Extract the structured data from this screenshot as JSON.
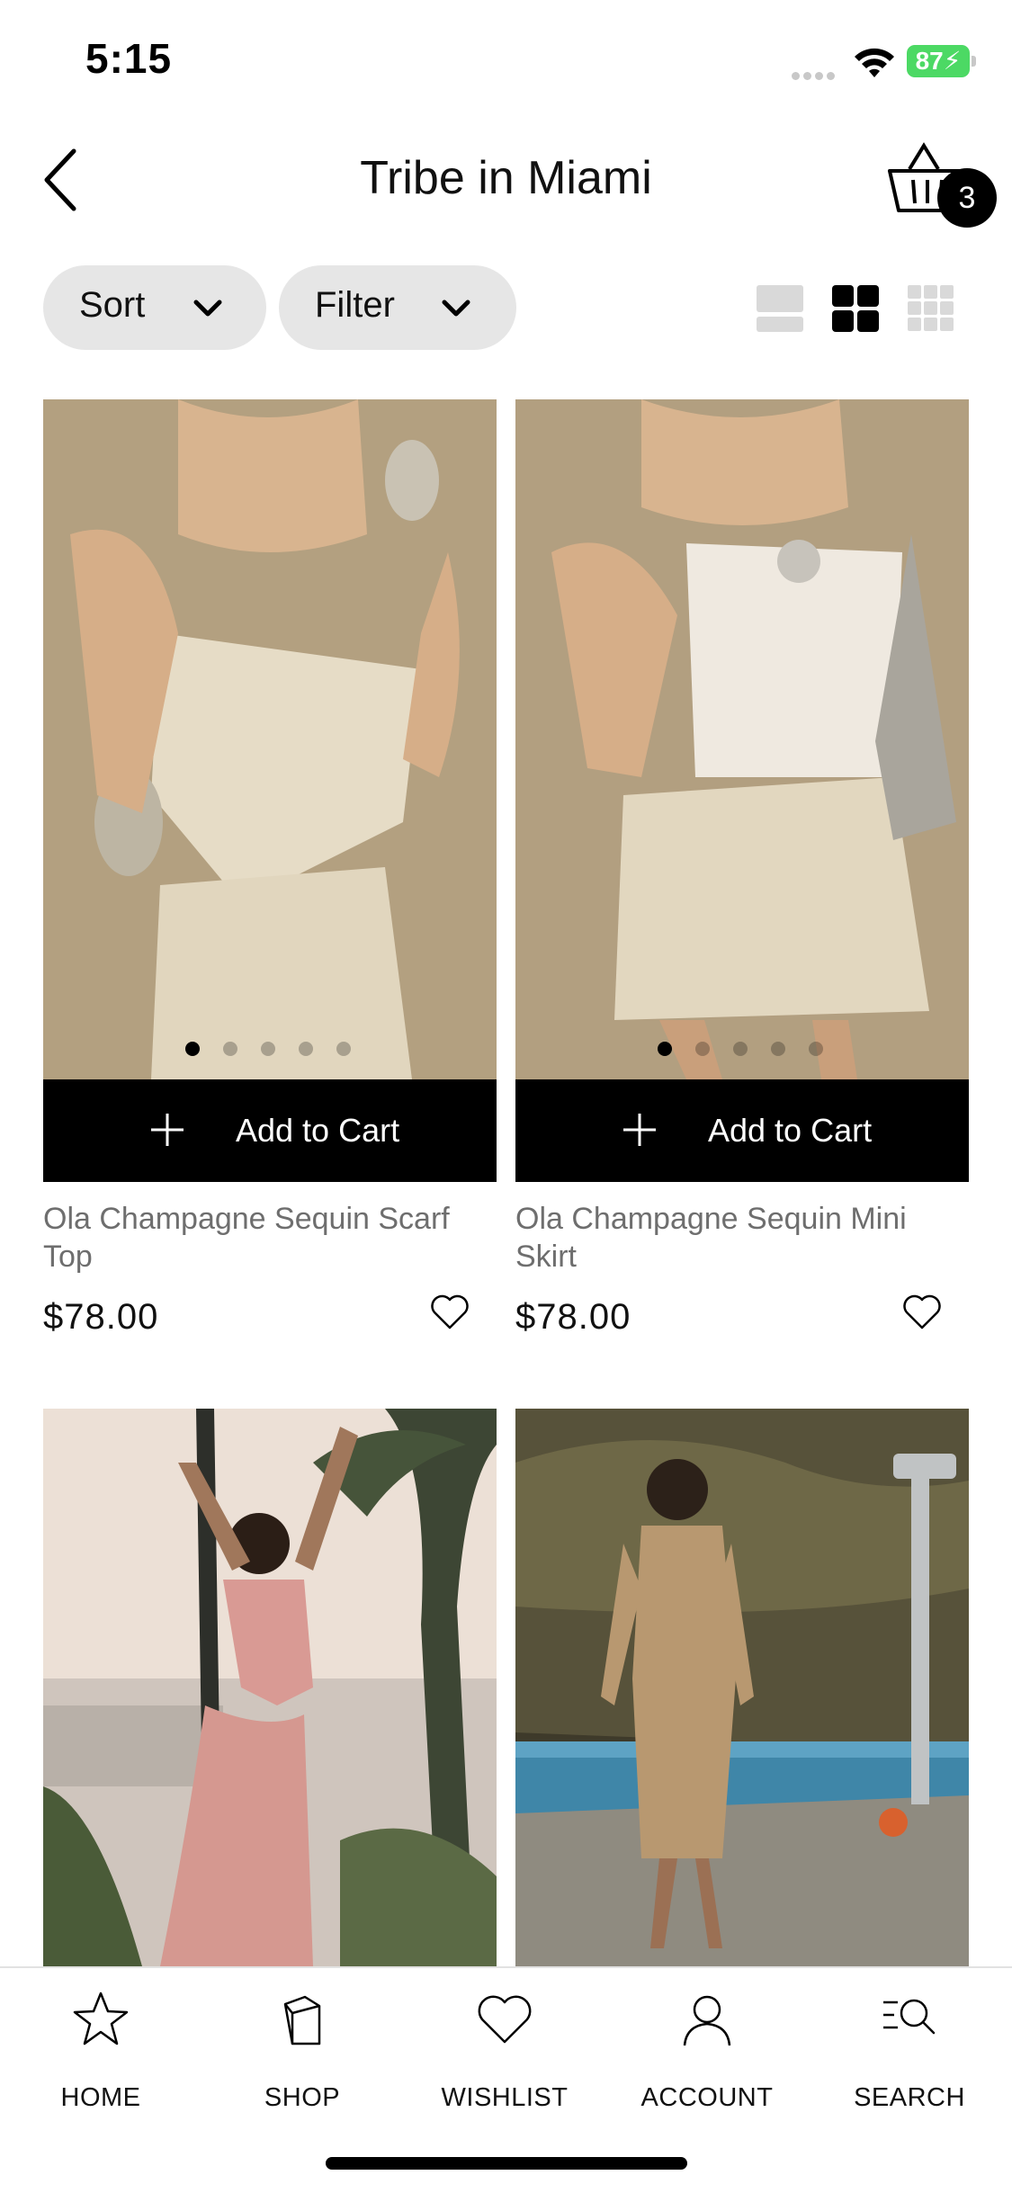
{
  "status": {
    "time": "5:15",
    "battery": "87"
  },
  "header": {
    "title": "Tribe in Miami",
    "cart_count": "3"
  },
  "toolbar": {
    "sort_label": "Sort",
    "filter_label": "Filter",
    "view_modes": [
      "list-view-icon",
      "grid-2-view-icon",
      "grid-3-view-icon"
    ],
    "active_view": "grid-2-view-icon"
  },
  "products": [
    {
      "name": "Ola Champagne Sequin Scarf Top",
      "price": "$78.00",
      "cta": "Add to Cart",
      "image_count": 5,
      "active_image": 1
    },
    {
      "name": "Ola Champagne Sequin Mini Skirt",
      "price": "$78.00",
      "cta": "Add to Cart",
      "image_count": 5,
      "active_image": 1
    },
    {
      "name": "",
      "price": "",
      "cta": ""
    },
    {
      "name": "",
      "price": "",
      "cta": ""
    }
  ],
  "tabbar": {
    "items": [
      {
        "label": "HOME",
        "icon": "star-icon"
      },
      {
        "label": "SHOP",
        "icon": "shopping-bag-icon"
      },
      {
        "label": "WISHLIST",
        "icon": "heart-icon"
      },
      {
        "label": "ACCOUNT",
        "icon": "user-icon"
      },
      {
        "label": "SEARCH",
        "icon": "search-icon"
      }
    ]
  },
  "colors": {
    "accent": "#000000",
    "pill_bg": "#e6e6e6",
    "battery": "#4cd964"
  }
}
